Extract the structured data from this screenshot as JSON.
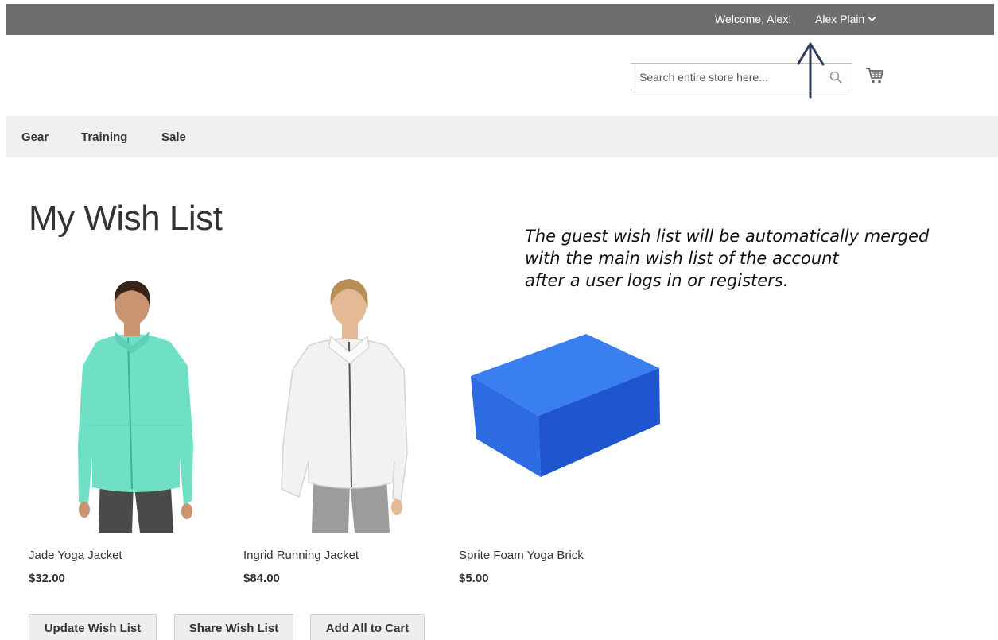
{
  "header": {
    "welcome_text": "Welcome, Alex!",
    "account_name": "Alex Plain",
    "search": {
      "placeholder": "Search entire store here..."
    }
  },
  "nav": {
    "items": [
      {
        "label": "Gear"
      },
      {
        "label": "Training"
      },
      {
        "label": "Sale"
      }
    ]
  },
  "page": {
    "title": "My Wish List"
  },
  "annotation": {
    "lines": [
      "The guest wish list will be automatically merged",
      "with the main wish list of the account",
      "after a user logs in or registers."
    ]
  },
  "products": [
    {
      "name": "Jade Yoga Jacket",
      "price": "$32.00",
      "color": "#6fe0c4"
    },
    {
      "name": "Ingrid Running Jacket",
      "price": "$84.00",
      "color": "#f2f2f2"
    },
    {
      "name": "Sprite Foam Yoga Brick",
      "price": "$5.00",
      "color": "#2f6fe8"
    }
  ],
  "actions": {
    "update_label": "Update Wish List",
    "share_label": "Share Wish List",
    "add_all_label": "Add All to Cart"
  },
  "colors": {
    "top_bar": "#6e6e6e",
    "nav_bar": "#f0f0f0",
    "arrow": "#2c3e5c"
  }
}
